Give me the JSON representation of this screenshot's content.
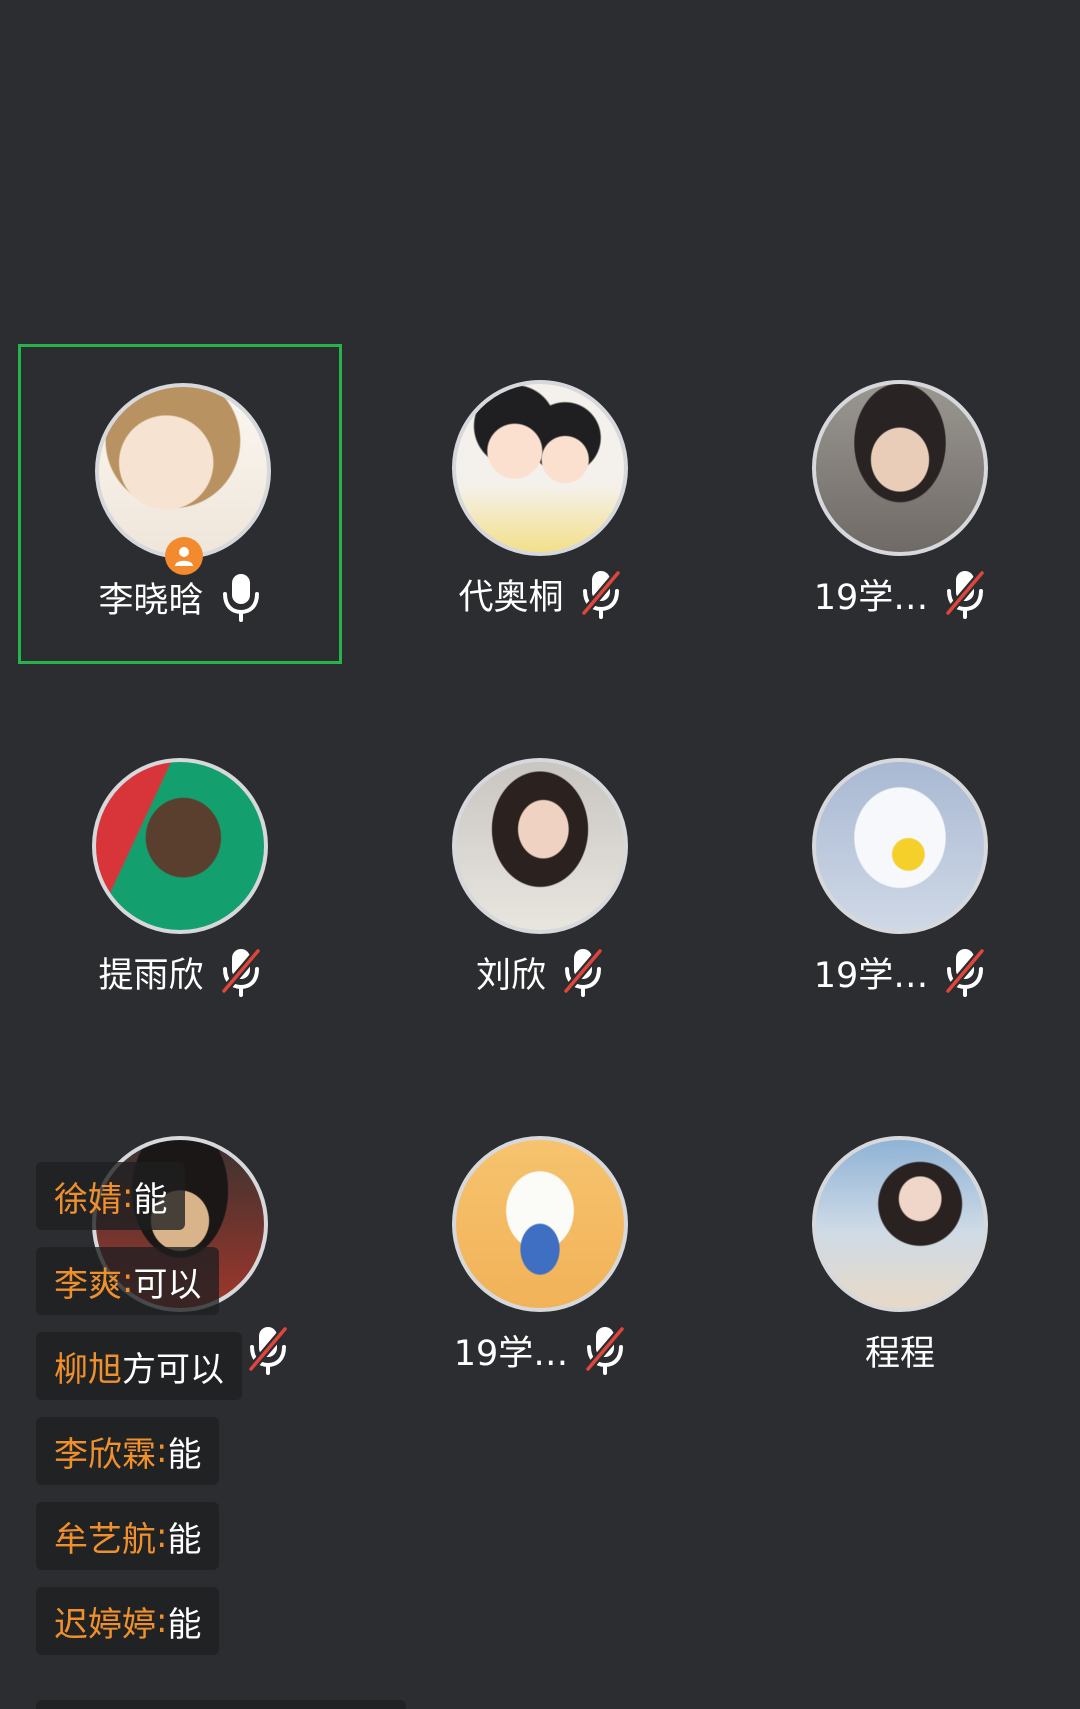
{
  "participants": [
    {
      "name": "李晓晗",
      "mic": "on",
      "host": true,
      "active": true
    },
    {
      "name": "代奥桐",
      "mic": "muted",
      "host": false,
      "active": false
    },
    {
      "name": "19学…",
      "mic": "muted",
      "host": false,
      "active": false
    },
    {
      "name": "提雨欣",
      "mic": "muted",
      "host": false,
      "active": false
    },
    {
      "name": "刘欣",
      "mic": "muted",
      "host": false,
      "active": false
    },
    {
      "name": "19学…",
      "mic": "muted",
      "host": false,
      "active": false
    },
    {
      "name": "",
      "mic": "muted",
      "host": false,
      "active": false
    },
    {
      "name": "19学…",
      "mic": "muted",
      "host": false,
      "active": false
    },
    {
      "name": "程程",
      "mic": "none",
      "host": false,
      "active": false
    }
  ],
  "chat": [
    {
      "name": "徐婧",
      "sep": ": ",
      "text": "能"
    },
    {
      "name": "李爽",
      "sep": ": ",
      "text": "可以"
    },
    {
      "name": "柳旭",
      "sep": "",
      "text": "方可以"
    },
    {
      "name": "李欣霖",
      "sep": ": ",
      "text": "能"
    },
    {
      "name": "牟艺航",
      "sep": ": ",
      "text": "能"
    },
    {
      "name": "迟婷婷",
      "sep": ": ",
      "text": "能"
    }
  ],
  "colors": {
    "background": "#2b2d30",
    "active_border": "#25b34a",
    "host_badge": "#f38a2e",
    "chat_name": "#f0902c",
    "mute_slash": "#e0453b"
  },
  "icons": {
    "mic_on": "microphone-icon",
    "mic_muted": "microphone-muted-icon",
    "host": "host-person-icon"
  }
}
